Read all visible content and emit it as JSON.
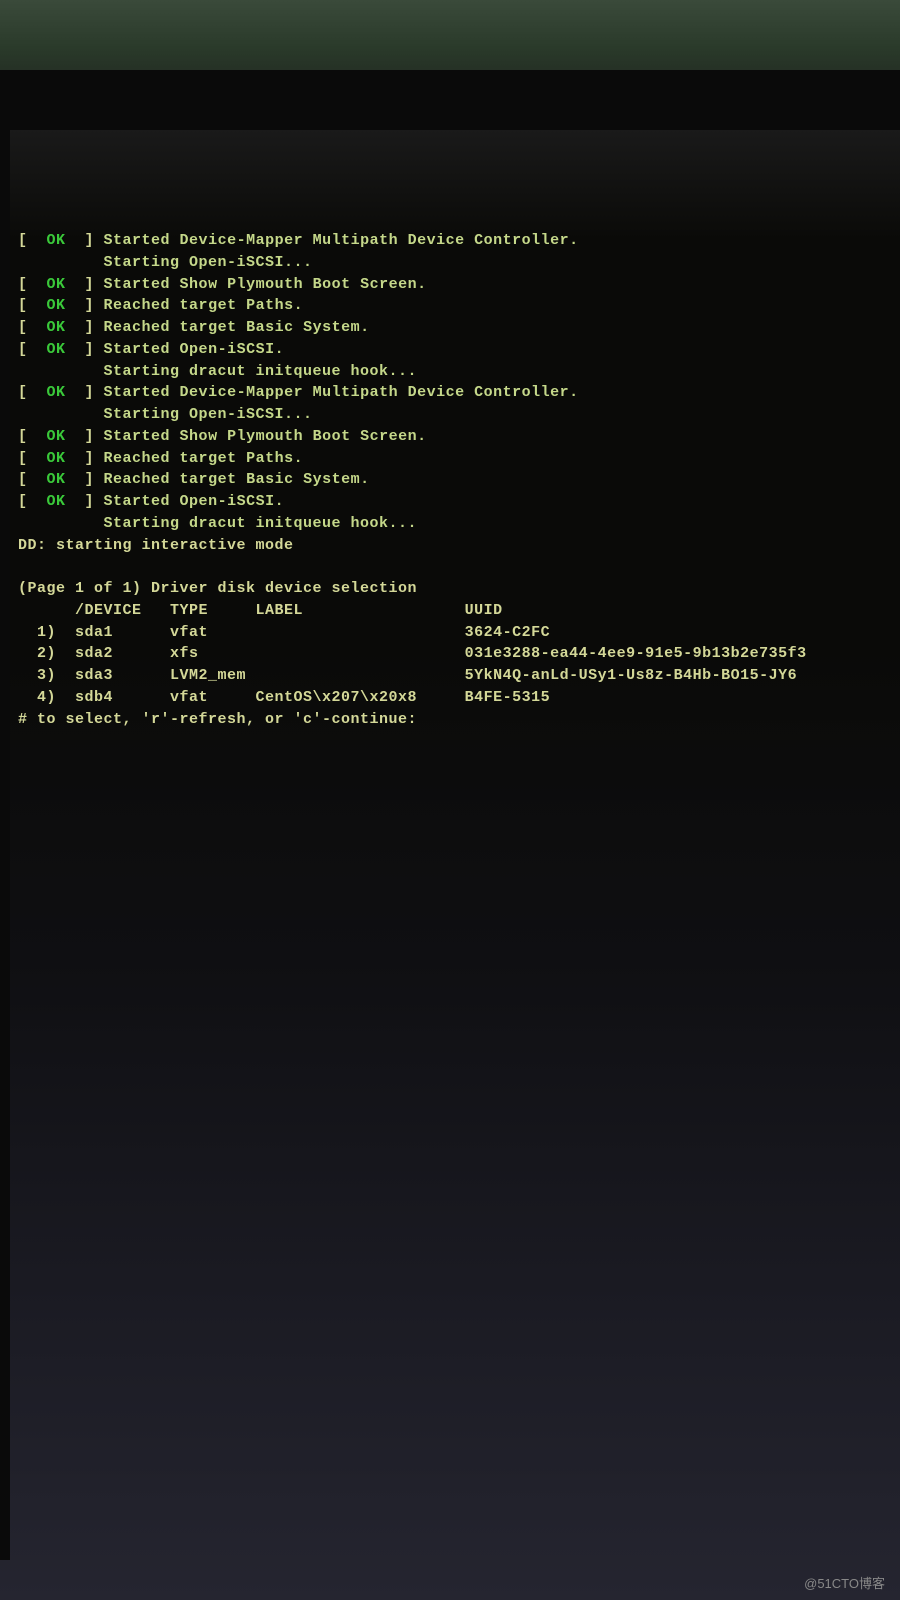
{
  "boot_lines": [
    {
      "status": "OK",
      "text": "Started Device-Mapper Multipath Device Controller."
    },
    {
      "status": null,
      "text": "Starting Open-iSCSI..."
    },
    {
      "status": "OK",
      "text": "Started Show Plymouth Boot Screen."
    },
    {
      "status": "OK",
      "text": "Reached target Paths."
    },
    {
      "status": "OK",
      "text": "Reached target Basic System."
    },
    {
      "status": "OK",
      "text": "Started Open-iSCSI."
    },
    {
      "status": null,
      "text": "Starting dracut initqueue hook..."
    },
    {
      "status": "OK",
      "text": "Started Device-Mapper Multipath Device Controller."
    },
    {
      "status": null,
      "text": "Starting Open-iSCSI..."
    },
    {
      "status": "OK",
      "text": "Started Show Plymouth Boot Screen."
    },
    {
      "status": "OK",
      "text": "Reached target Paths."
    },
    {
      "status": "OK",
      "text": "Reached target Basic System."
    },
    {
      "status": "OK",
      "text": "Started Open-iSCSI."
    },
    {
      "status": null,
      "text": "Starting dracut initqueue hook..."
    }
  ],
  "dd_mode": "DD: starting interactive mode",
  "page_header": "(Page 1 of 1) Driver disk device selection",
  "table_header": {
    "device": "/DEVICE",
    "type": "TYPE",
    "label": "LABEL",
    "uuid": "UUID"
  },
  "devices": [
    {
      "num": "1)",
      "device": "sda1",
      "type": "vfat",
      "label": "",
      "uuid": "3624-C2FC"
    },
    {
      "num": "2)",
      "device": "sda2",
      "type": "xfs",
      "label": "",
      "uuid": "031e3288-ea44-4ee9-91e5-9b13b2e735f3"
    },
    {
      "num": "3)",
      "device": "sda3",
      "type": "LVM2_mem",
      "label": "",
      "uuid": "5YkN4Q-anLd-USy1-Us8z-B4Hb-BO15-JY6"
    },
    {
      "num": "4)",
      "device": "sdb4",
      "type": "vfat",
      "label": "CentOS\\x207\\x20x8",
      "uuid": "B4FE-5315"
    }
  ],
  "prompt": "# to select, 'r'-refresh, or 'c'-continue:",
  "watermark": "@51CTO博客"
}
